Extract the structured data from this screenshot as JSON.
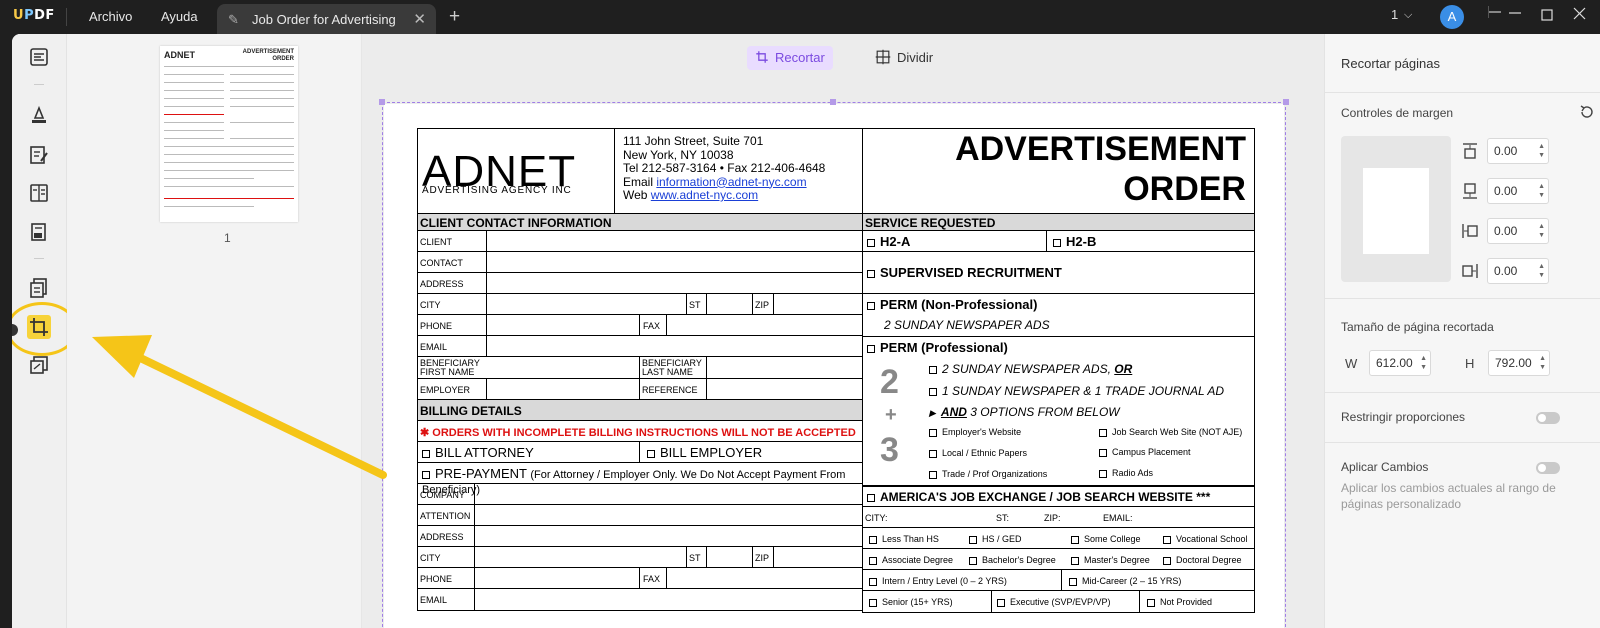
{
  "app": {
    "logo": "UPDF",
    "menu": [
      "Archivo",
      "Ayuda"
    ]
  },
  "tab": {
    "title": "Job Order for Advertising"
  },
  "titlebar": {
    "page_count": "1",
    "avatar_letter": "A"
  },
  "colors": {
    "accent": "#7b4ae0",
    "highlight": "#f5c518",
    "avatar": "#3a8ee6"
  },
  "thumbnails": {
    "page_number": "1"
  },
  "canvas_toolbar": {
    "crop_label": "Recortar",
    "split_label": "Dividir"
  },
  "document": {
    "logo_big": "ADNET",
    "logo_sub": "ADVERTISING AGENCY INC",
    "address": [
      "111 John Street, Suite 701",
      "New York, NY 10038",
      "Tel 212-587-3164 • Fax 212-406-4648"
    ],
    "email_label": "Email ",
    "email": "information@adnet-nyc.com",
    "web_label": "Web ",
    "web": "www.adnet-nyc.com",
    "title_line1": "ADVERTISEMENT",
    "title_line2": "ORDER",
    "client_section": "CLIENT CONTACT INFORMATION",
    "client_fields": {
      "client": "CLIENT",
      "contact": "CONTACT",
      "address": "ADDRESS",
      "city": "CITY",
      "st": "ST",
      "zip": "ZIP",
      "phone": "PHONE",
      "fax": "FAX",
      "email": "EMAIL",
      "ben_first_1": "BENEFICIARY",
      "ben_first_2": "FIRST NAME",
      "ben_last_1": "BENEFICIARY",
      "ben_last_2": "LAST NAME",
      "employer": "EMPLOYER",
      "reference": "REFERENCE"
    },
    "billing_section": "BILLING DETAILS",
    "billing_warning": "✱ ORDERS WITH INCOMPLETE BILLING INSTRUCTIONS WILL NOT BE ACCEPTED",
    "bill_attorney": "BILL ATTORNEY",
    "bill_employer": "BILL EMPLOYER",
    "prepayment": "PRE-PAYMENT",
    "prepayment_note": "(For Attorney / Employer Only. We Do Not Accept Payment From Beneficiary)",
    "billing_fields": {
      "company": "COMPANY",
      "attention": "ATTENTION",
      "address": "ADDRESS",
      "city": "CITY",
      "st": "ST",
      "zip": "ZIP",
      "phone": "PHONE",
      "fax": "FAX",
      "email": "EMAIL"
    },
    "service_section": "SERVICE REQUESTED",
    "h2a": "H2-A",
    "h2b": "H2-B",
    "supervised": "SUPERVISED RECRUITMENT",
    "perm_np": "PERM (Non-Professional)",
    "perm_np_sub": "2 SUNDAY NEWSPAPER ADS",
    "perm_p": "PERM (Professional)",
    "opt1a": "2 SUNDAY NEWSPAPER ADS, ",
    "opt1b": "OR",
    "opt2": "1 SUNDAY NEWSPAPER & 1 TRADE JOURNAL AD",
    "opt3a": "AND",
    "opt3b": " 3 OPTIONS FROM BELOW",
    "big2": "2",
    "bigplus": "+",
    "big3": "3",
    "media": [
      "Employer's Website",
      "Job Search Web Site (NOT AJE)",
      "Local / Ethnic Papers",
      "Campus Placement",
      "Trade / Prof Organizations",
      "Radio Ads"
    ],
    "aje": "AMERICA'S JOB EXCHANGE / JOB SEARCH WEBSITE ***",
    "aje_city": "CITY:",
    "aje_st": "ST:",
    "aje_zip": "ZIP:",
    "aje_email": "EMAIL:",
    "edu": [
      "Less Than HS",
      "HS / GED",
      "Some College",
      "Vocational School",
      "Associate Degree",
      "Bachelor's Degree",
      "Master's Degree",
      "Doctoral Degree"
    ],
    "levels": [
      "Intern / Entry Level (0 – 2 YRS)",
      "Mid-Career (2 – 15 YRS)",
      "Senior (15+ YRS)",
      "Executive (SVP/EVP/VP)",
      "Not Provided"
    ]
  },
  "right_panel": {
    "title": "Recortar páginas",
    "margin_controls": "Controles de margen",
    "margins": {
      "top": "0.00",
      "bottom": "0.00",
      "left": "0.00",
      "right": "0.00"
    },
    "page_size_label": "Tamaño de página recortada",
    "w_label": "W",
    "w_value": "612.00",
    "h_label": "H",
    "h_value": "792.00",
    "restrict_label": "Restringir proporciones",
    "apply_label": "Aplicar Cambios",
    "apply_desc": "Aplicar los cambios actuales al rango de páginas personalizado"
  }
}
